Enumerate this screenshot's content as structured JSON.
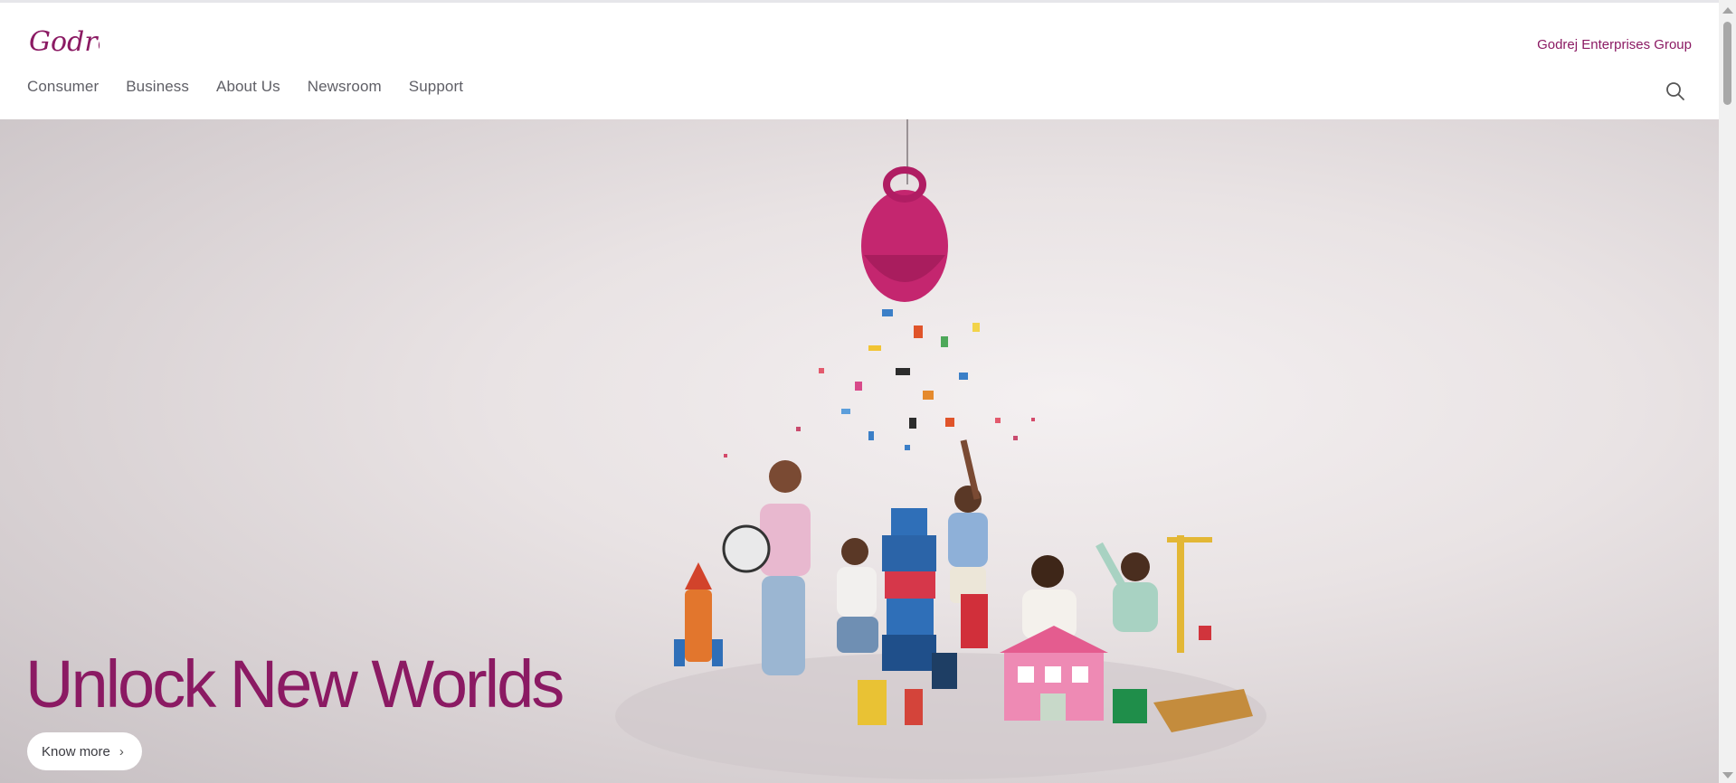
{
  "brand": {
    "logo_text": "Godrej",
    "color": "#8b1a63"
  },
  "header": {
    "nav": [
      {
        "label": "Consumer"
      },
      {
        "label": "Business"
      },
      {
        "label": "About Us"
      },
      {
        "label": "Newsroom"
      },
      {
        "label": "Support"
      }
    ],
    "group_link": "Godrej Enterprises Group",
    "search_icon": "search-icon"
  },
  "hero": {
    "headline": "Unlock New Worlds",
    "cta_label": "Know more",
    "cta_icon": "chevron-right-icon"
  },
  "colors": {
    "accent": "#8b1a63",
    "nav_text": "#5f5f66",
    "hero_bg": "#e9e3e4"
  }
}
